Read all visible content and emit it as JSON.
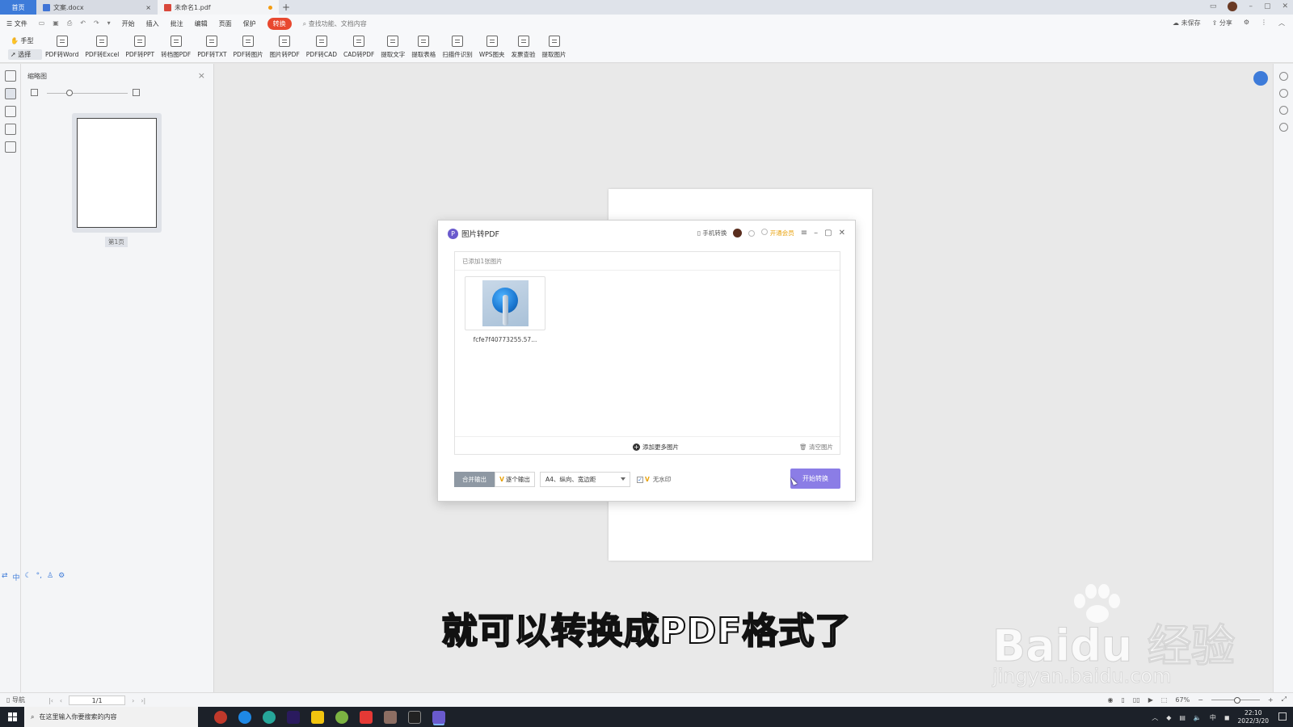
{
  "tabs": {
    "home": "首页",
    "items": [
      {
        "label": "文案.docx",
        "type": "word"
      },
      {
        "label": "未命名1.pdf",
        "type": "pdf"
      }
    ]
  },
  "menu": {
    "file": "文件",
    "items": [
      "开始",
      "插入",
      "批注",
      "编辑",
      "页面",
      "保护",
      "转换"
    ],
    "active": "转换",
    "search": "查找功能、文档内容",
    "right": [
      "未保存",
      "分享"
    ]
  },
  "ribbon": {
    "hand": "手型",
    "select": "选择",
    "buttons": [
      "PDF转Word",
      "PDF转Excel",
      "PDF转PPT",
      "转档图PDF",
      "PDF转TXT",
      "PDF转图片",
      "图片转PDF",
      "PDF转CAD",
      "CAD转PDF",
      "提取文字",
      "提取表格",
      "扫描件识别",
      "WPS图夹",
      "发票查验",
      "提取图片"
    ]
  },
  "thumbnail": {
    "title": "缩略图",
    "page_label": "第1页"
  },
  "dialog": {
    "title": "图片转PDF",
    "mobile": "手机转换",
    "vip": "开通会员",
    "count": "已添加1张图片",
    "image_name": "fcfe7f40773255.57...",
    "add_more": "添加更多图片",
    "clear": "清空图片",
    "merge": "合并输出",
    "each": "逐个输出",
    "page_setting": "A4、纵向、宽边距",
    "watermark": "无水印",
    "start": "开始转换"
  },
  "statusbar": {
    "nav": "导航",
    "page": "1/1",
    "zoom": "67%"
  },
  "taskbar": {
    "search": "在这里输入你要搜索的内容",
    "lang": "中",
    "time": "22:10",
    "date": "2022/3/20"
  },
  "subtitle": "就可以转换成PDF格式了",
  "watermark": {
    "brand": "Baidu 经验",
    "url": "jingyan.baidu.com"
  },
  "colors": {
    "accent_blue": "#3d7bd9",
    "convert_red": "#e8482f",
    "start_button": "#8b7de6",
    "vip_gold": "#e8a10b"
  }
}
